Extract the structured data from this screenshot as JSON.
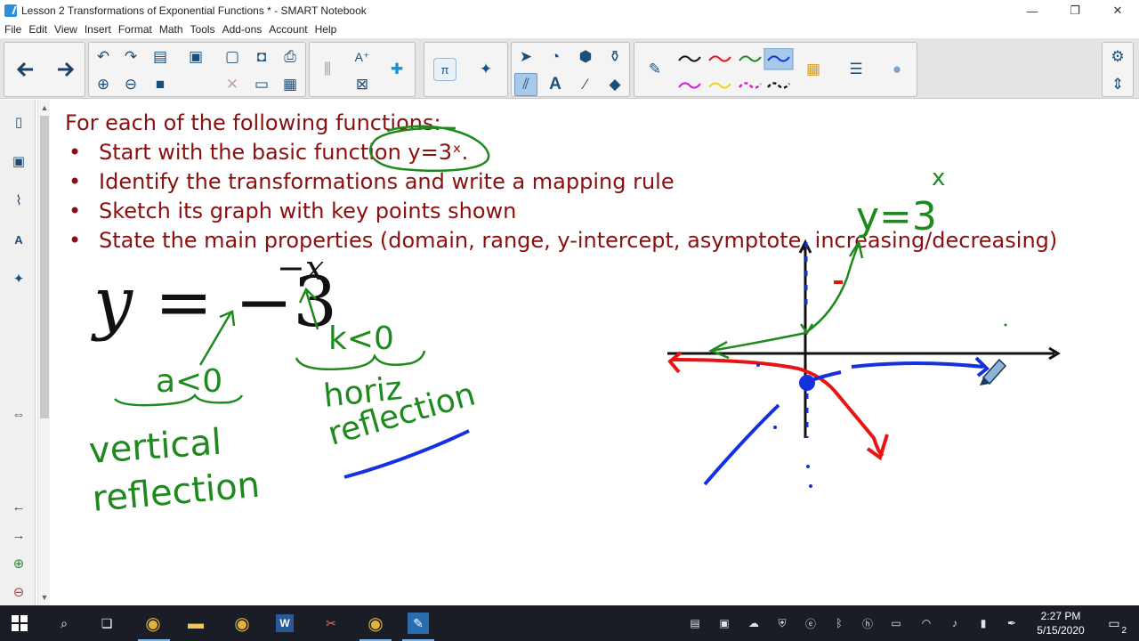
{
  "window": {
    "title": "Lesson 2 Transformations of Exponential Functions * - SMART Notebook",
    "minimize_glyph": "—",
    "restore_glyph": "❐",
    "close_glyph": "✕"
  },
  "menu": [
    "File",
    "Edit",
    "View",
    "Insert",
    "Format",
    "Math",
    "Tools",
    "Add-ons",
    "Account",
    "Help"
  ],
  "slide": {
    "heading": "For each of the following functions:",
    "bullet_glyph": "•",
    "bullets": [
      "Start with the basic function y=3ˣ.",
      "Identify the transformations and write a mapping rule",
      "Sketch its graph with key points shown",
      "State the main properties (domain, range, y-intercept, asymptote, increasing/decreasing)"
    ],
    "equation": {
      "lhs": "y",
      "equals": "=",
      "coefficient": "−3",
      "exponent": "−x"
    }
  },
  "handwriting": {
    "a_note": "a<0",
    "k_note": "k<0",
    "vertical_1": "vertical",
    "vertical_2": "reflection",
    "horiz_1": "horiz",
    "horiz_2": "reflection",
    "graph_label": "y=3",
    "graph_label_exp": "x"
  },
  "colors": {
    "instruction_text": "#8b0f0f",
    "ink_green": "#1e8a1e",
    "ink_red": "#e81414",
    "ink_blue": "#1431e0",
    "axis": "#111111"
  },
  "taskbar": {
    "time": "2:27 PM",
    "date": "5/15/2020",
    "notification_count": "2"
  }
}
